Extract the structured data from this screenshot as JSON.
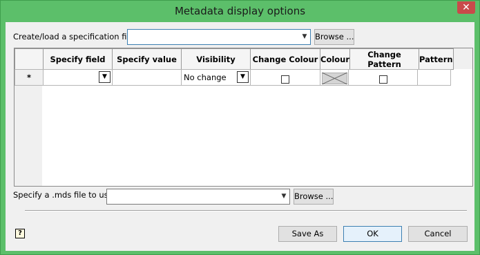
{
  "window": {
    "title": "Metadata display options",
    "close_label": "✕"
  },
  "spec_file": {
    "label": "Create/load a specification file",
    "value": "",
    "browse_label": "Browse ..."
  },
  "grid": {
    "columns": [
      "Specify field",
      "Specify value",
      "Visibility",
      "Change Colour",
      "Colour",
      "Change Pattern",
      "Pattern"
    ],
    "new_row": {
      "marker": "*",
      "field": "",
      "value": "",
      "visibility": "No change",
      "change_colour": false,
      "colour": "",
      "change_pattern": false,
      "pattern": ""
    }
  },
  "mds_file": {
    "label": "Specify a .mds file to use",
    "value": "",
    "browse_label": "Browse ..."
  },
  "footer": {
    "help_label": "?",
    "save_as_label": "Save As",
    "ok_label": "OK",
    "cancel_label": "Cancel"
  },
  "colors": {
    "title_bar": "#5cbf6a",
    "client": "#f0f0f0",
    "default_button_border": "#3c7fb1"
  }
}
